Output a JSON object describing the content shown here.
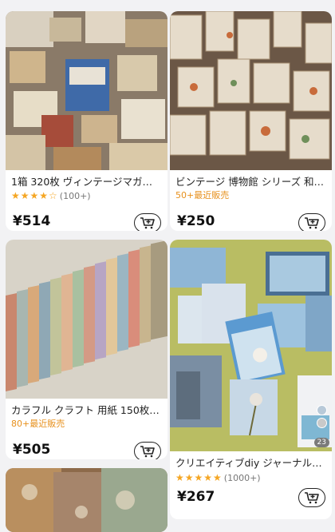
{
  "products": [
    {
      "title": "1箱 320枚 ヴィンテージマガ…",
      "rating_stars": "★★★★☆",
      "rating_count": "(100+)",
      "price": "¥514"
    },
    {
      "title": "ビンテージ 博物館 シリーズ 和…",
      "sold": "50+最近販売",
      "price": "¥250"
    },
    {
      "title": "カラフル クラフト 用紙 150枚…",
      "sold": "80+最近販売",
      "price": "¥505"
    },
    {
      "title": "クリエイティブdiy ジャーナル…",
      "rating_stars": "★★★★★",
      "rating_count": "(1000+)",
      "price": "¥267",
      "image_count": "23"
    }
  ],
  "icons": {
    "cart": "add-to-cart-icon"
  },
  "colors": {
    "sold_text": "#e7901c",
    "stars": "#f5a623"
  }
}
